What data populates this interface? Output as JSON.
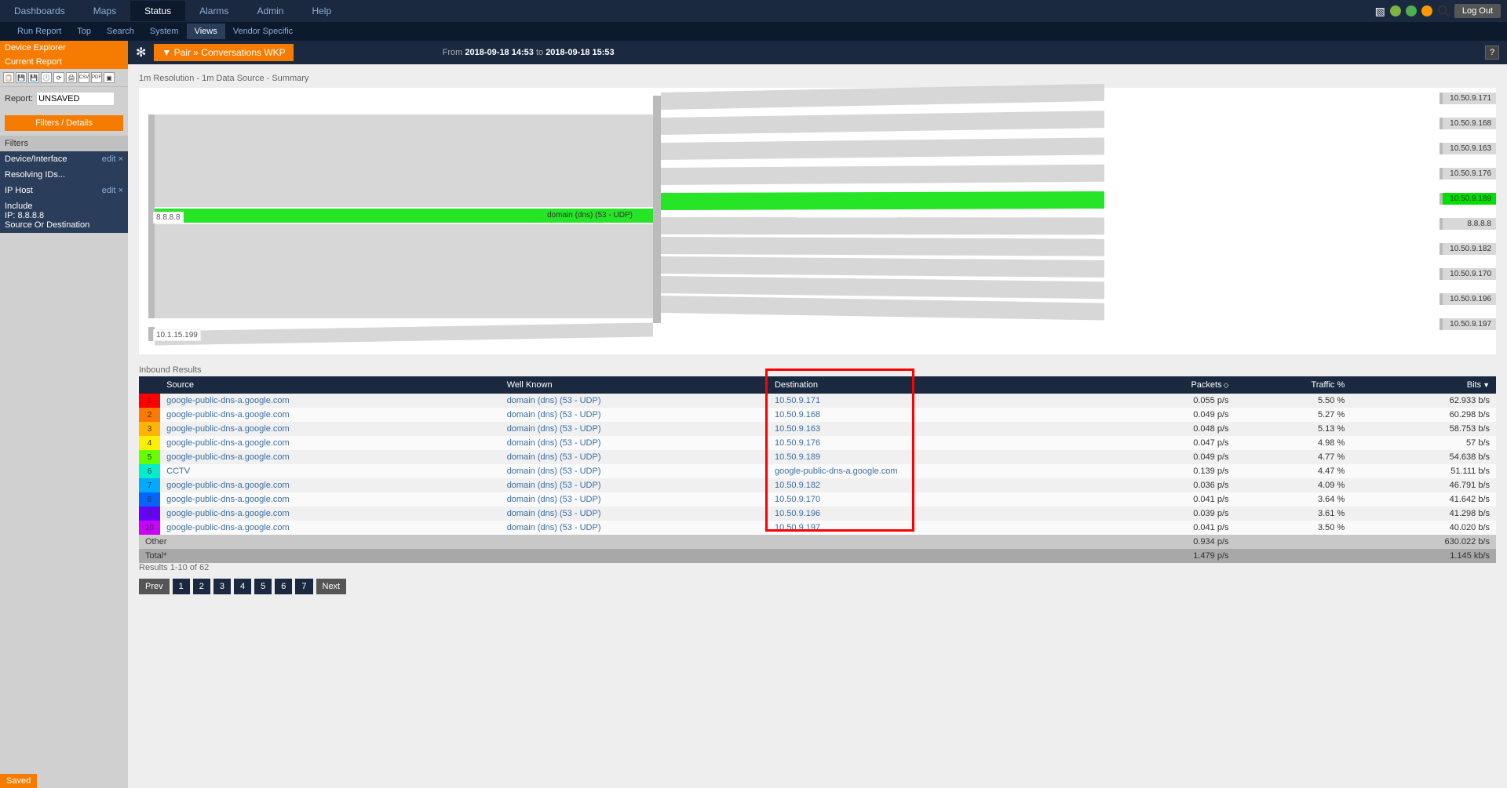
{
  "topnav": [
    "Dashboards",
    "Maps",
    "Status",
    "Alarms",
    "Admin",
    "Help"
  ],
  "topnav_active": 2,
  "logout": "Log Out",
  "subnav": [
    "Run Report",
    "Top",
    "Search",
    "System",
    "Views",
    "Vendor Specific"
  ],
  "subnav_active": 4,
  "sidebar": {
    "section1": "Device Explorer",
    "section2": "Current Report",
    "report_label": "Report:",
    "report_value": "UNSAVED",
    "filters_btn": "Filters / Details",
    "filters_title": "Filters",
    "di_label": "Device/Interface",
    "di_edit": "edit",
    "resolving": "Resolving IDs...",
    "iphost_label": "IP Host",
    "iphost_edit": "edit",
    "include": "Include",
    "ip": "IP: 8.8.8.8",
    "srcdst": "Source Or Destination",
    "saved": "Saved"
  },
  "breadcrumb": {
    "text": "▼ Pair » Conversations WKP",
    "from_label": "From",
    "from": "2018-09-18 14:53",
    "to_label": "to",
    "to": "2018-09-18 15:53",
    "help": "?"
  },
  "summary": "1m Resolution - 1m Data Source - Summary",
  "chart_data": {
    "type": "sankey",
    "left_nodes": [
      "8.8.8.8",
      "10.1.15.199"
    ],
    "middle": "domain (dns) (53 - UDP)",
    "right_nodes": [
      "10.50.9.171",
      "10.50.9.168",
      "10.50.9.163",
      "10.50.9.176",
      "10.50.9.189",
      "8.8.8.8",
      "10.50.9.182",
      "10.50.9.170",
      "10.50.9.196",
      "10.50.9.197"
    ],
    "highlighted": "10.50.9.189"
  },
  "results_title": "Inbound Results",
  "cols": [
    "Source",
    "Well Known",
    "Destination",
    "Packets",
    "Traffic %",
    "Bits"
  ],
  "sort_col": 5,
  "rows": [
    {
      "n": 1,
      "c": "#ff0000",
      "src": "google-public-dns-a.google.com",
      "wk": "domain (dns) (53 - UDP)",
      "dst": "10.50.9.171",
      "pk": "0.055 p/s",
      "tr": "5.50 %",
      "bi": "62.933 b/s"
    },
    {
      "n": 2,
      "c": "#ff7800",
      "src": "google-public-dns-a.google.com",
      "wk": "domain (dns) (53 - UDP)",
      "dst": "10.50.9.168",
      "pk": "0.049 p/s",
      "tr": "5.27 %",
      "bi": "60.298 b/s"
    },
    {
      "n": 3,
      "c": "#ffb400",
      "src": "google-public-dns-a.google.com",
      "wk": "domain (dns) (53 - UDP)",
      "dst": "10.50.9.163",
      "pk": "0.048 p/s",
      "tr": "5.13 %",
      "bi": "58.753 b/s"
    },
    {
      "n": 4,
      "c": "#ffee00",
      "src": "google-public-dns-a.google.com",
      "wk": "domain (dns) (53 - UDP)",
      "dst": "10.50.9.176",
      "pk": "0.047 p/s",
      "tr": "4.98 %",
      "bi": "57 b/s"
    },
    {
      "n": 5,
      "c": "#66ff00",
      "src": "google-public-dns-a.google.com",
      "wk": "domain (dns) (53 - UDP)",
      "dst": "10.50.9.189",
      "pk": "0.049 p/s",
      "tr": "4.77 %",
      "bi": "54.638 b/s"
    },
    {
      "n": 6,
      "c": "#00eecc",
      "src": "CCTV",
      "wk": "domain (dns) (53 - UDP)",
      "dst": "google-public-dns-a.google.com",
      "pk": "0.139 p/s",
      "tr": "4.47 %",
      "bi": "51.111 b/s"
    },
    {
      "n": 7,
      "c": "#00aaff",
      "src": "google-public-dns-a.google.com",
      "wk": "domain (dns) (53 - UDP)",
      "dst": "10.50.9.182",
      "pk": "0.036 p/s",
      "tr": "4.09 %",
      "bi": "46.791 b/s"
    },
    {
      "n": 8,
      "c": "#0066ff",
      "src": "google-public-dns-a.google.com",
      "wk": "domain (dns) (53 - UDP)",
      "dst": "10.50.9.170",
      "pk": "0.041 p/s",
      "tr": "3.64 %",
      "bi": "41.642 b/s"
    },
    {
      "n": 9,
      "c": "#6600ff",
      "src": "google-public-dns-a.google.com",
      "wk": "domain (dns) (53 - UDP)",
      "dst": "10.50.9.196",
      "pk": "0.039 p/s",
      "tr": "3.61 %",
      "bi": "41.298 b/s"
    },
    {
      "n": 10,
      "c": "#cc00ff",
      "src": "google-public-dns-a.google.com",
      "wk": "domain (dns) (53 - UDP)",
      "dst": "10.50.9.197",
      "pk": "0.041 p/s",
      "tr": "3.50 %",
      "bi": "40.020 b/s"
    }
  ],
  "other": {
    "label": "Other",
    "pk": "0.934 p/s",
    "bi": "630.022 b/s"
  },
  "total": {
    "label": "Total*",
    "pk": "1.479 p/s",
    "bi": "1.145 kb/s"
  },
  "pg_info": "Results 1-10 of 62",
  "pg_prev": "Prev",
  "pg_next": "Next",
  "pg_nums": [
    "1",
    "2",
    "3",
    "4",
    "5",
    "6",
    "7"
  ]
}
